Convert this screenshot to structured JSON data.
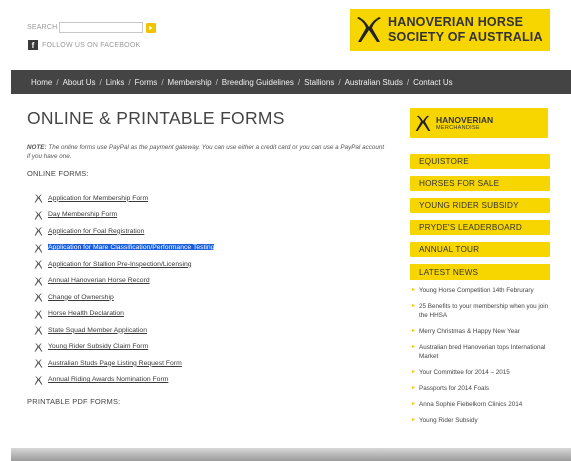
{
  "header": {
    "search_label": "SEARCH",
    "search_value": "",
    "facebook_label": "FOLLOW US ON FACEBOOK",
    "logo_line1": "HANOVERIAN HORSE",
    "logo_line2": "SOCIETY OF AUSTRALIA"
  },
  "nav": {
    "items": [
      "Home",
      "About Us",
      "Links",
      "Forms",
      "Membership",
      "Breeding Guidelines",
      "Stallions",
      "Australian Studs",
      "Contact Us"
    ],
    "separator": "/"
  },
  "main": {
    "title": "ONLINE & PRINTABLE FORMS",
    "note_label": "NOTE:",
    "note_text": " The online forms use PayPal as the payment gateway. You can use either a credit card or you can use a PayPal account if you have one.",
    "online_heading": "ONLINE FORMS:",
    "forms": [
      "Application for Membership Form",
      "Day Membership Form",
      "Application for Foal Registration",
      "Application for Mare Classification/Performance Testing",
      "Application for Stallion Pre-Inspection/Licensing",
      "Annual Hanoverian Horse Record",
      "Change of Ownership",
      "Horse Health Declaration",
      "State Squad Member Application",
      "Young Rider Subsidy Claim Form",
      "Australian Studs Page Listing Request Form",
      "Annual Riding Awards Nomination Form"
    ],
    "selected_form": "Application for Mare Classification/Performance Testing",
    "pdf_heading": "PRINTABLE PDF FORMS:"
  },
  "sidebar": {
    "merch_title": "HANOVERIAN",
    "merch_sub": "MERCHANDISE",
    "buttons": [
      "EQUISTORE",
      "HORSES FOR SALE",
      "YOUNG RIDER SUBSIDY",
      "PRYDE'S LEADERBOARD",
      "ANNUAL TOUR"
    ],
    "news_heading": "LATEST NEWS",
    "news": [
      "Young Horse Competition 14th Februrary",
      "25 Benefits to your membership when you join the HHSA",
      "Merry Christmas & Happy New Year",
      "Australian bred Hanoverian tops International Market",
      "Your Committee for 2014 – 2015",
      "Passports for 2014 Foals",
      "Anna Sophie Fiebelkorn Clinics 2014",
      "Young Rider Subsidy"
    ]
  },
  "colors": {
    "brand_yellow": "#f7d600",
    "nav_bg": "#444444",
    "selection": "#1a5fe0"
  },
  "icons": {
    "logo": "crossed-horse-heads-icon",
    "search_button": "search-arrow-icon",
    "facebook": "facebook-icon",
    "form_bullet": "crossed-horse-heads-icon",
    "news_bullet": "arrow-right-icon"
  }
}
